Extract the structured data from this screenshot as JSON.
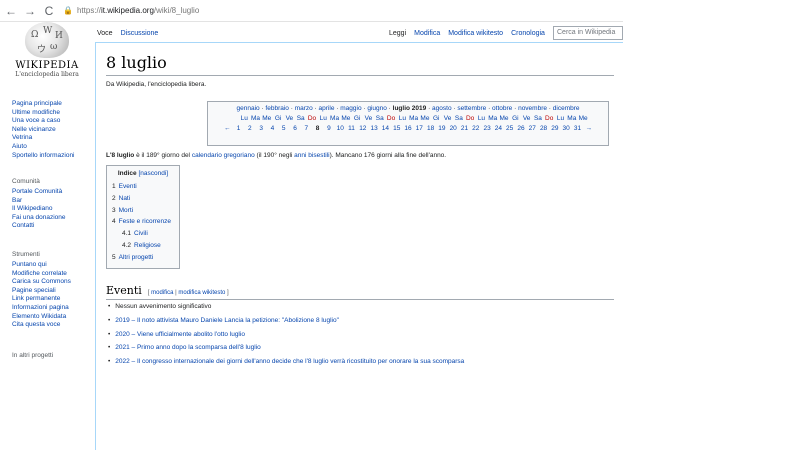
{
  "browser": {
    "back": "←",
    "forward": "→",
    "reload": "C",
    "lock": "🔒",
    "url_prefix": "https://",
    "url_domain": "it.wikipedia.org",
    "url_path": "/wiki/8_luglio"
  },
  "logo": {
    "wordmark": "WIKIPEDIA",
    "tagline": "L'enciclopedia libera"
  },
  "sidebar": {
    "nav_items": [
      "Pagina principale",
      "Ultime modifiche",
      "Una voce a caso",
      "Nelle vicinanze",
      "Vetrina",
      "Aiuto",
      "Sportello informazioni"
    ],
    "community_title": "Comunità",
    "community_items": [
      "Portale Comunità",
      "Bar",
      "Il Wikipediano",
      "Fai una donazione",
      "Contatti"
    ],
    "tools_title": "Strumenti",
    "tools_items": [
      "Puntano qui",
      "Modifiche correlate",
      "Carica su Commons",
      "Pagine speciali",
      "Link permanente",
      "Informazioni pagina",
      "Elemento Wikidata",
      "Cita questa voce"
    ],
    "other_title": "In altri progetti"
  },
  "tabs": {
    "voce": "Voce",
    "discussione": "Discussione",
    "leggi": "Leggi",
    "modifica": "Modifica",
    "modifica_wikitesto": "Modifica wikitesto",
    "cronologia": "Cronologia",
    "search_placeholder": "Cerca in Wikipedia"
  },
  "article": {
    "title": "8 luglio",
    "subtitle": "Da Wikipedia, l'enciclopedia libera.",
    "intro_bold": "L'8 luglio",
    "intro_1": " è il 189° giorno del ",
    "intro_link1": "calendario gregoriano",
    "intro_2": " (il 190° negli ",
    "intro_link2": "anni bisestili",
    "intro_3": "). Mancano 176 giorni alla fine dell'anno."
  },
  "calendar": {
    "months_before": [
      "gennaio",
      "febbraio",
      "marzo",
      "aprile",
      "maggio",
      "giugno"
    ],
    "current_month": "luglio 2019",
    "months_after": [
      "agosto",
      "settembre",
      "ottobre",
      "novembre",
      "dicembre"
    ],
    "separator": " · ",
    "dows": [
      "Lu",
      "Ma",
      "Me",
      "Gi",
      "Ve",
      "Sa",
      "Do",
      "Lu",
      "Ma",
      "Me",
      "Gi",
      "Ve",
      "Sa",
      "Do",
      "Lu",
      "Ma",
      "Me",
      "Gi",
      "Ve",
      "Sa",
      "Do",
      "Lu",
      "Ma",
      "Me",
      "Gi",
      "Ve",
      "Sa",
      "Do",
      "Lu",
      "Ma",
      "Me"
    ],
    "prev_arrow": "←",
    "next_arrow": "→",
    "days": [
      "1",
      "2",
      "3",
      "4",
      "5",
      "6",
      "7",
      "8",
      "9",
      "10",
      "11",
      "12",
      "13",
      "14",
      "15",
      "16",
      "17",
      "18",
      "19",
      "20",
      "21",
      "22",
      "23",
      "24",
      "25",
      "26",
      "27",
      "28",
      "29",
      "30",
      "31"
    ],
    "today": "8"
  },
  "toc": {
    "title": "Indice",
    "hide_label": "[nascondi]",
    "items": [
      {
        "num": "1",
        "label": "Eventi",
        "sub": false
      },
      {
        "num": "2",
        "label": "Nati",
        "sub": false
      },
      {
        "num": "3",
        "label": "Morti",
        "sub": false
      },
      {
        "num": "4",
        "label": "Feste e ricorrenze",
        "sub": false
      },
      {
        "num": "4.1",
        "label": "Civili",
        "sub": true
      },
      {
        "num": "4.2",
        "label": "Religiose",
        "sub": true
      },
      {
        "num": "5",
        "label": "Altri progetti",
        "sub": false
      }
    ]
  },
  "section": {
    "title": "Eventi",
    "edit_open": "[ ",
    "edit_1": "modifica",
    "edit_sep": " | ",
    "edit_2": "modifica wikitesto",
    "edit_close": " ]"
  },
  "events": [
    {
      "year": "",
      "text": "Nessun avvenimento significativo"
    },
    {
      "year": "2019",
      "text": " – Il noto attivista Mauro Daniele Lancia la petizione: \"Abolizione 8 luglio\""
    },
    {
      "year": "2020",
      "text": " – Viene ufficialmente abolito l'otto luglio"
    },
    {
      "year": "2021",
      "text": " – Primo anno dopo la scomparsa dell'8 luglio"
    },
    {
      "year": "2022",
      "text": " – Il congresso internazionale dei giorni dell'anno decide che l'8 luglio verrà ricostituito per onorare la sua scomparsa"
    }
  ]
}
